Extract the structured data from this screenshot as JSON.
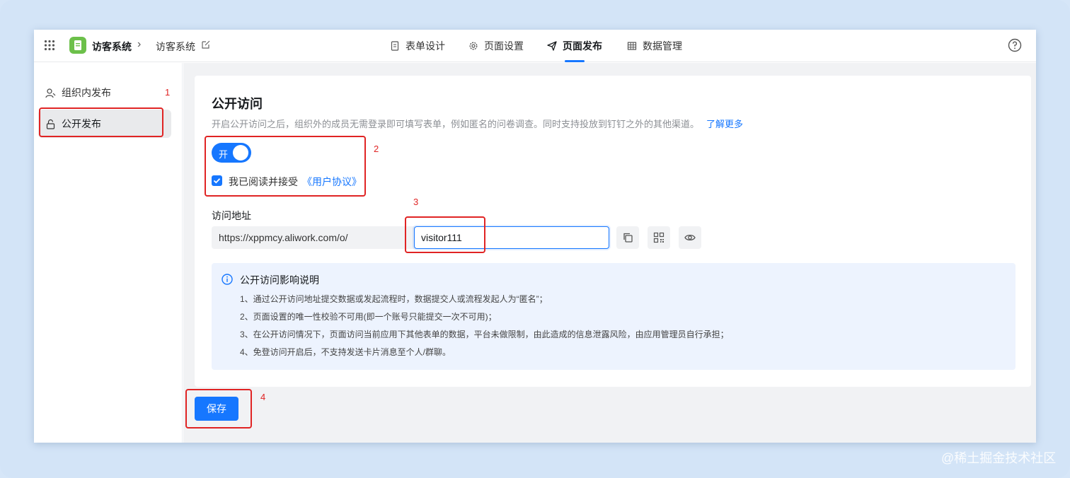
{
  "header": {
    "app_name": "访客系统",
    "breadcrumb_separator": "›",
    "page_name": "访客系统",
    "tabs": [
      {
        "label": "表单设计",
        "icon": "document-icon"
      },
      {
        "label": "页面设置",
        "icon": "gear-icon"
      },
      {
        "label": "页面发布",
        "icon": "send-icon",
        "active": true
      },
      {
        "label": "数据管理",
        "icon": "table-icon"
      }
    ]
  },
  "sidebar": {
    "items": [
      {
        "label": "组织内发布",
        "icon": "users-icon",
        "active": false
      },
      {
        "label": "公开发布",
        "icon": "unlock-icon",
        "active": true
      }
    ]
  },
  "main": {
    "title": "公开访问",
    "description": "开启公开访问之后，组织外的成员无需登录即可填写表单，例如匿名的问卷调查。同时支持投放到钉钉之外的其他渠道。",
    "learn_more": "了解更多",
    "toggle_label": "开",
    "toggle_on": true,
    "agree_checked": true,
    "agree_text": "我已阅读并接受",
    "agreement_link": "《用户协议》",
    "address_label": "访问地址",
    "url_prefix": "https://xppmcy.aliwork.com/o/",
    "url_suffix_value": "visitor111",
    "notice": {
      "title": "公开访问影响说明",
      "lines": [
        "1、通过公开访问地址提交数据或发起流程时，数据提交人或流程发起人为“匿名”；",
        "2、页面设置的唯一性校验不可用(即一个账号只能提交一次不可用)；",
        "3、在公开访问情况下，页面访问当前应用下其他表单的数据，平台未做限制，由此造成的信息泄露风险，由应用管理员自行承担；",
        "4、免登访问开启后，不支持发送卡片消息至个人/群聊。"
      ]
    },
    "save_label": "保存"
  },
  "annotations": [
    "1",
    "2",
    "3",
    "4"
  ],
  "watermark": "@稀土掘金技术社区",
  "colors": {
    "accent": "#1677ff",
    "annotation": "#e02424",
    "app_logo": "#6cc04a"
  }
}
